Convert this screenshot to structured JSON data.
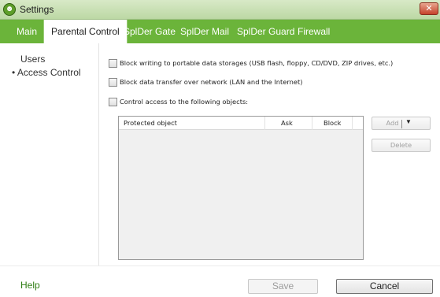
{
  "window": {
    "title": "Settings",
    "close_glyph": "✕"
  },
  "tabs": [
    {
      "label": "Main",
      "active": false
    },
    {
      "label": "Parental Control",
      "active": true
    },
    {
      "label": "SplDer Gate",
      "active": false
    },
    {
      "label": "SplDer Mail",
      "active": false
    },
    {
      "label": "SplDer Guard",
      "active": false
    },
    {
      "label": "Firewall",
      "active": false
    }
  ],
  "sidebar": {
    "items": [
      {
        "label": "Users"
      },
      {
        "label": "• Access Control"
      }
    ]
  },
  "options": [
    {
      "label": "Block writing to portable data storages (USB flash, floppy, CD/DVD, ZIP drives, etc.)",
      "checked": false
    },
    {
      "label": "Block data transfer over network (LAN and the Internet)",
      "checked": false
    },
    {
      "label": "Control access to the following objects:",
      "checked": false
    }
  ],
  "table": {
    "columns": [
      "Protected object",
      "Ask",
      "Block"
    ],
    "rows": []
  },
  "table_actions": {
    "add_label": "Add",
    "delete_label": "Delete"
  },
  "footer": {
    "help_label": "Help",
    "save_label": "Save",
    "cancel_label": "Cancel"
  },
  "colors": {
    "accent": "#6bb43a",
    "help_link": "#2e7d12"
  }
}
